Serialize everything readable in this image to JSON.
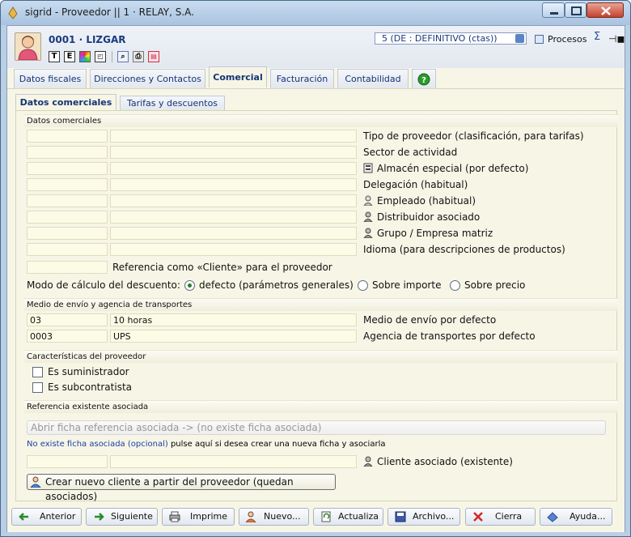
{
  "window": {
    "title": "sigrid - Proveedor || 1 · RELAY, S.A."
  },
  "header": {
    "code_name": "0001 · LIZGAR",
    "status_value": "5 (DE : DEFINITIVO (ctas))",
    "procesos_label": "Procesos",
    "sigma": "Σ",
    "pin": "⊣◼",
    "icons": [
      "T",
      "E",
      "◩",
      "▣",
      "🔍",
      "⎙",
      "📄"
    ]
  },
  "tabs": [
    {
      "label": "Datos fiscales"
    },
    {
      "label": "Direcciones y Contactos"
    },
    {
      "label": "Comercial"
    },
    {
      "label": "Facturación"
    },
    {
      "label": "Contabilidad"
    }
  ],
  "subtabs": [
    {
      "label": "Datos comerciales"
    },
    {
      "label": "Tarifas y descuentos"
    }
  ],
  "section_comercial": {
    "title": "Datos comerciales",
    "rows": [
      {
        "label": "Tipo de proveedor (clasificación, para tarifas)",
        "code": "",
        "value": ""
      },
      {
        "label": "Sector de actividad",
        "code": "",
        "value": ""
      },
      {
        "label": "Almacén especial (por defecto)",
        "code": "",
        "value": ""
      },
      {
        "label": "Delegación (habitual)",
        "code": "",
        "value": ""
      },
      {
        "label": "Empleado (habitual)",
        "code": "",
        "value": ""
      },
      {
        "label": "Distribuidor asociado",
        "code": "",
        "value": ""
      },
      {
        "label": "Grupo / Empresa matriz",
        "code": "",
        "value": ""
      },
      {
        "label": "Idioma (para descripciones de productos)",
        "code": "",
        "value": ""
      }
    ],
    "referencia_label": "Referencia como «Cliente» para el proveedor",
    "referencia_value": "",
    "modo_label": "Modo de cálculo del descuento:",
    "modo_options": [
      {
        "label": "defecto (parámetros generales)",
        "selected": true
      },
      {
        "label": "Sobre importe",
        "selected": false
      },
      {
        "label": "Sobre precio",
        "selected": false
      }
    ]
  },
  "section_envio": {
    "title": "Medio de envío y agencia de transportes",
    "rows": [
      {
        "code": "03",
        "value": "10 horas",
        "label": "Medio de envío por defecto"
      },
      {
        "code": "0003",
        "value": "UPS",
        "label": "Agencia de transportes por defecto"
      }
    ]
  },
  "section_caracteristicas": {
    "title": "Características del proveedor",
    "checks": [
      {
        "label": "Es suministrador",
        "checked": false
      },
      {
        "label": "Es subcontratista",
        "checked": false
      }
    ]
  },
  "section_referencia": {
    "title": "Referencia existente asociada",
    "open_button": "Abrir ficha referencia asociada ->  (no existe ficha asociada)",
    "note_link": "No existe ficha asociada (opcional)",
    "note_text": " pulse aquí si desea crear una nueva ficha y asociarla",
    "cliente_label": "Cliente asociado (existente)",
    "cliente_code": "",
    "cliente_value": "",
    "create_button": "Crear nuevo cliente a partir del proveedor (quedan asociados)"
  },
  "buttons": [
    {
      "label": "Anterior"
    },
    {
      "label": "Siguiente"
    },
    {
      "label": "Imprime"
    },
    {
      "label": "Nuevo..."
    },
    {
      "label": "Actualiza"
    },
    {
      "label": "Archivo..."
    },
    {
      "label": "Cierra"
    },
    {
      "label": "Ayuda..."
    }
  ],
  "colors": {
    "accent": "#1a3a80",
    "panel_bg": "#f7f6e6",
    "field_bg": "#fbfbe6"
  }
}
